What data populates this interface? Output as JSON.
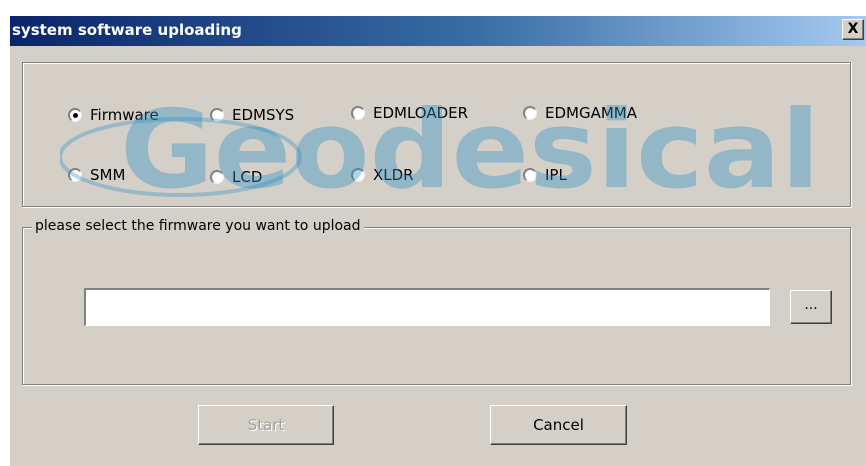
{
  "window": {
    "title": "system software uploading",
    "close_label": "X"
  },
  "upload_type": {
    "options": [
      {
        "label": "Firmware",
        "checked": true
      },
      {
        "label": "EDMSYS",
        "checked": false
      },
      {
        "label": "EDMLOADER",
        "checked": false
      },
      {
        "label": "EDMGAMMA",
        "checked": false
      },
      {
        "label": "SMM",
        "checked": false
      },
      {
        "label": "LCD",
        "checked": false
      },
      {
        "label": "XLDR",
        "checked": false
      },
      {
        "label": "IPL",
        "checked": false
      }
    ]
  },
  "file_select": {
    "legend": "please select the firmware you want to upload",
    "path_value": "",
    "browse_label": "..."
  },
  "actions": {
    "start_label": "Start",
    "start_enabled": false,
    "cancel_label": "Cancel"
  },
  "watermark": {
    "text": "Geodesical",
    "color": "#2a8fc6"
  }
}
